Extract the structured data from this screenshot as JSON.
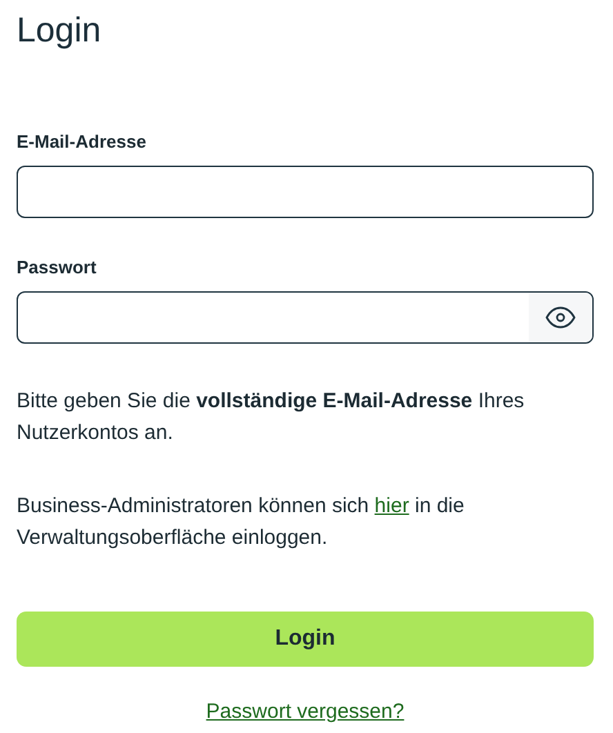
{
  "title": "Login",
  "fields": [
    {
      "label": "E-Mail-Adresse",
      "kind": "text"
    },
    {
      "label": "Passwort",
      "kind": "password"
    }
  ],
  "info": "Bitte geben Sie die **vollständige E-Mail-Adresse** Ihres Nutzerkontos an.",
  "admin_note": {
    "before": "Business-Administratoren können sich ",
    "link": "hier",
    "after": " in die Verwaltungsoberfläche einloggen."
  },
  "login_button": "Login",
  "forgot_link": "Passwort vergessen?"
}
